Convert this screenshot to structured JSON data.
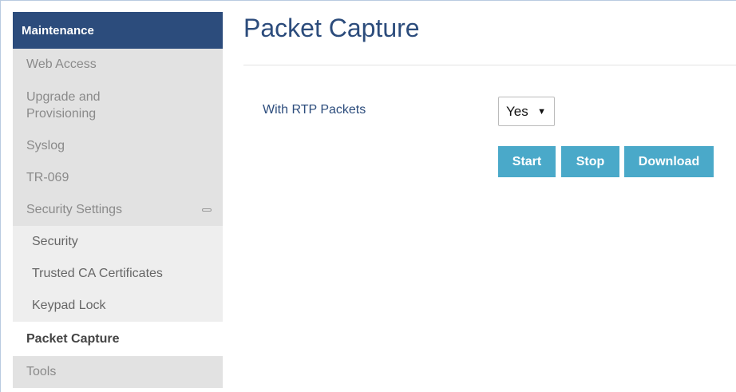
{
  "sidebar": {
    "header": "Maintenance",
    "items": [
      {
        "label": "Web Access"
      },
      {
        "label": "Upgrade and Provisioning"
      },
      {
        "label": "Syslog"
      },
      {
        "label": "TR-069"
      },
      {
        "label": "Security Settings",
        "expanded": true
      },
      {
        "label": "Security"
      },
      {
        "label": "Trusted CA Certificates"
      },
      {
        "label": "Keypad Lock"
      },
      {
        "label": "Packet Capture",
        "active": true
      },
      {
        "label": "Tools"
      }
    ],
    "upgrade_line1": "Upgrade and",
    "upgrade_line2": "Provisioning"
  },
  "main": {
    "title": "Packet Capture",
    "rtp_label": "With RTP Packets",
    "rtp_value": "Yes",
    "dropdown_arrow": "▼",
    "buttons": {
      "start": "Start",
      "stop": "Stop",
      "download": "Download"
    }
  },
  "colors": {
    "header_bg": "#2c4c7c",
    "title": "#2c4c7c",
    "button_bg": "#4aa9c9",
    "sidebar_bg": "#e2e2e2"
  },
  "icons": {
    "collapse": "minus-collapse-icon"
  }
}
